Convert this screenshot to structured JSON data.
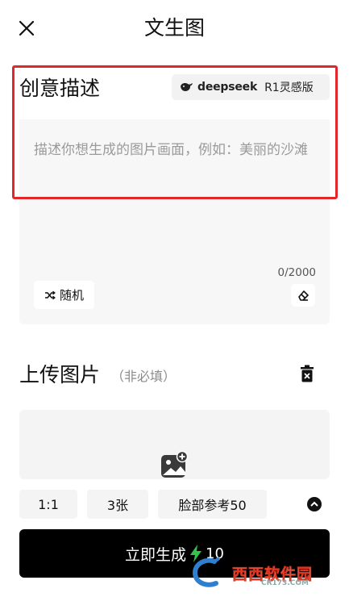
{
  "header": {
    "title": "文生图"
  },
  "prompt": {
    "section_title": "创意描述",
    "model_brand": "deepseek",
    "model_tag": "R1灵感版",
    "placeholder": "描述你想生成的图片画面，例如：美丽的沙滩",
    "char_count": "0/2000",
    "random_label": "随机"
  },
  "upload": {
    "title": "上传图片",
    "subtitle": "（非必填）"
  },
  "options": {
    "ratio": "1:1",
    "count": "3张",
    "face_ref": "脸部参考50"
  },
  "generate": {
    "label": "立即生成",
    "cost": "10"
  },
  "watermark": {
    "brand": "西西软件园",
    "domain": "CR173.COM"
  },
  "colors": {
    "highlight": "#e3262a",
    "primary_button": "#000000",
    "bolt": "#35c24a"
  }
}
